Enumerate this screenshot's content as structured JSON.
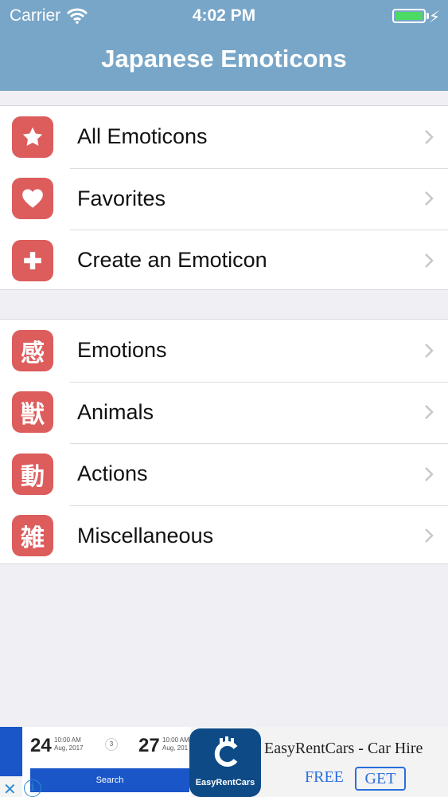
{
  "statusbar": {
    "carrier": "Carrier",
    "time": "4:02 PM"
  },
  "nav": {
    "title": "Japanese Emoticons"
  },
  "groups": [
    {
      "items": [
        {
          "label": "All Emoticons",
          "icon": "star-icon"
        },
        {
          "label": "Favorites",
          "icon": "heart-icon"
        },
        {
          "label": "Create an Emoticon",
          "icon": "plus-icon"
        }
      ]
    },
    {
      "items": [
        {
          "label": "Emotions",
          "glyph": "感"
        },
        {
          "label": "Animals",
          "glyph": "獣"
        },
        {
          "label": "Actions",
          "glyph": "動"
        },
        {
          "label": "Miscellaneous",
          "glyph": "雑"
        }
      ]
    }
  ],
  "ad": {
    "date1": "24",
    "time1": "10:00 AM",
    "month1": "Aug, 2017",
    "mid": "3",
    "date2": "27",
    "time2": "10:00 AM",
    "month2": "Aug, 201",
    "search": "Search",
    "logo_text": "EasyRentCars",
    "title": "EasyRentCars - Car Hire",
    "free": "FREE",
    "get": "GET"
  },
  "colors": {
    "nav": "#78a6c8",
    "icon": "#dd5c5c",
    "background": "#efeff4"
  }
}
